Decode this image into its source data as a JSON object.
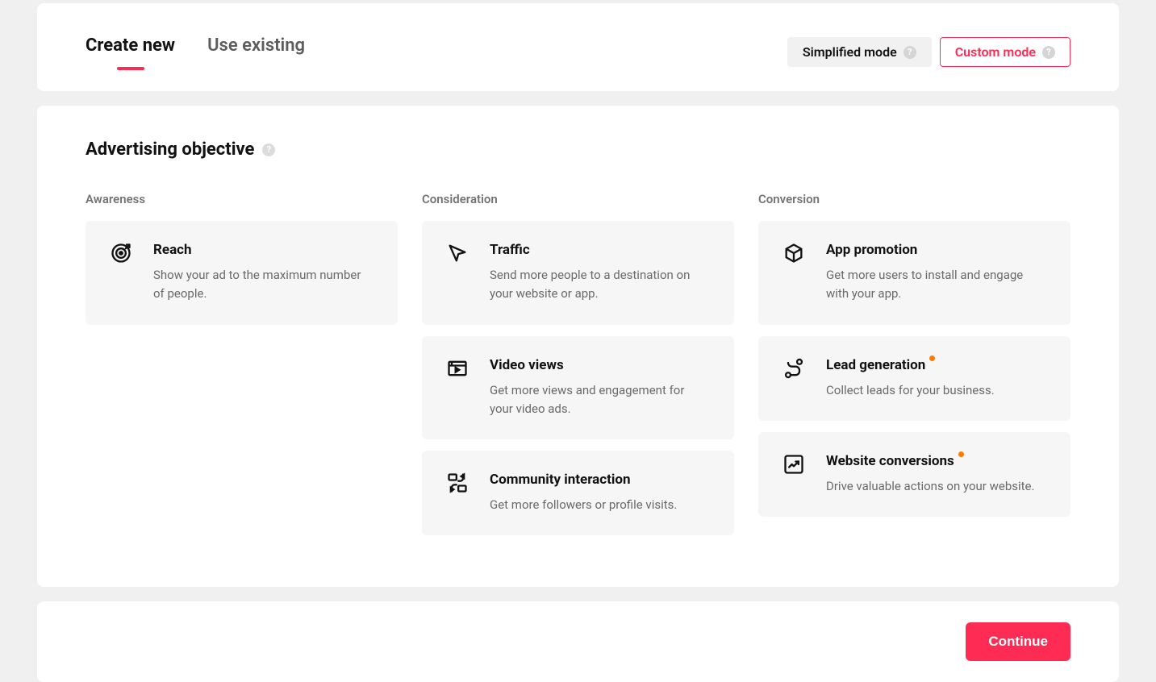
{
  "tabs": {
    "create_new": "Create new",
    "use_existing": "Use existing"
  },
  "modes": {
    "simplified": "Simplified mode",
    "custom": "Custom mode"
  },
  "section_title": "Advertising objective",
  "columns": {
    "awareness": {
      "label": "Awareness",
      "items": [
        {
          "title": "Reach",
          "desc": "Show your ad to the maximum number of people."
        }
      ]
    },
    "consideration": {
      "label": "Consideration",
      "items": [
        {
          "title": "Traffic",
          "desc": "Send more people to a destination on your website or app."
        },
        {
          "title": "Video views",
          "desc": "Get more views and engagement for your video ads."
        },
        {
          "title": "Community interaction",
          "desc": "Get more followers or profile visits."
        }
      ]
    },
    "conversion": {
      "label": "Conversion",
      "items": [
        {
          "title": "App promotion",
          "desc": "Get more users to install and engage with your app."
        },
        {
          "title": "Lead generation",
          "desc": "Collect leads for your business."
        },
        {
          "title": "Website conversions",
          "desc": "Drive valuable actions on your website."
        }
      ]
    }
  },
  "continue_label": "Continue"
}
